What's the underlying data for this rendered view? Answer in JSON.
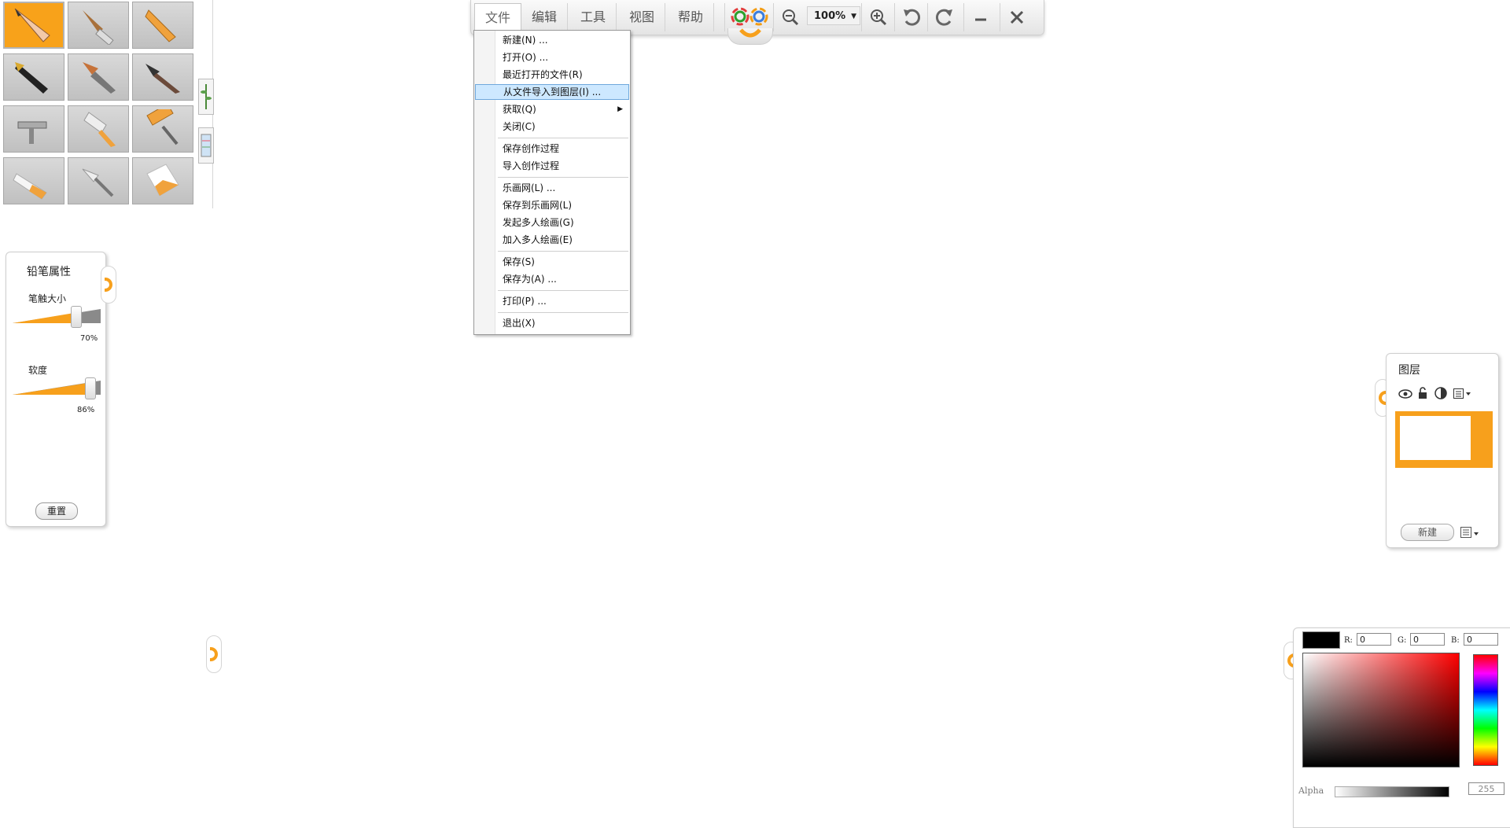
{
  "toolbar": {
    "menus": [
      "文件",
      "编辑",
      "工具",
      "视图",
      "帮助"
    ],
    "zoom_level": "100%"
  },
  "file_menu": {
    "items": [
      "新建(N) ...",
      "打开(O) ...",
      "最近打开的文件(R)",
      "从文件导入到图层(I) ...",
      "获取(Q)",
      "关闭(C)",
      "保存创作过程",
      "导入创作过程",
      "乐画网(L) ...",
      "保存到乐画网(L)",
      "发起多人绘画(G)",
      "加入多人绘画(E)",
      "保存(S)",
      "保存为(A) ...",
      "打印(P) ...",
      "退出(X)"
    ]
  },
  "brush": {
    "title": "铅笔属性",
    "size_label": "笔触大小",
    "size_value": 70,
    "size_pct": "70%",
    "softness_label": "软度",
    "softness_value": 86,
    "softness_pct": "86%",
    "reset_label": "重置"
  },
  "layers": {
    "title": "图层",
    "new_label": "新建"
  },
  "color": {
    "r_label": "R:",
    "r": "0",
    "g_label": "G:",
    "g": "0",
    "b_label": "B:",
    "b": "0",
    "alpha_label": "Alpha",
    "alpha": "255",
    "current": "#000000",
    "accent": "#f7a01c"
  }
}
